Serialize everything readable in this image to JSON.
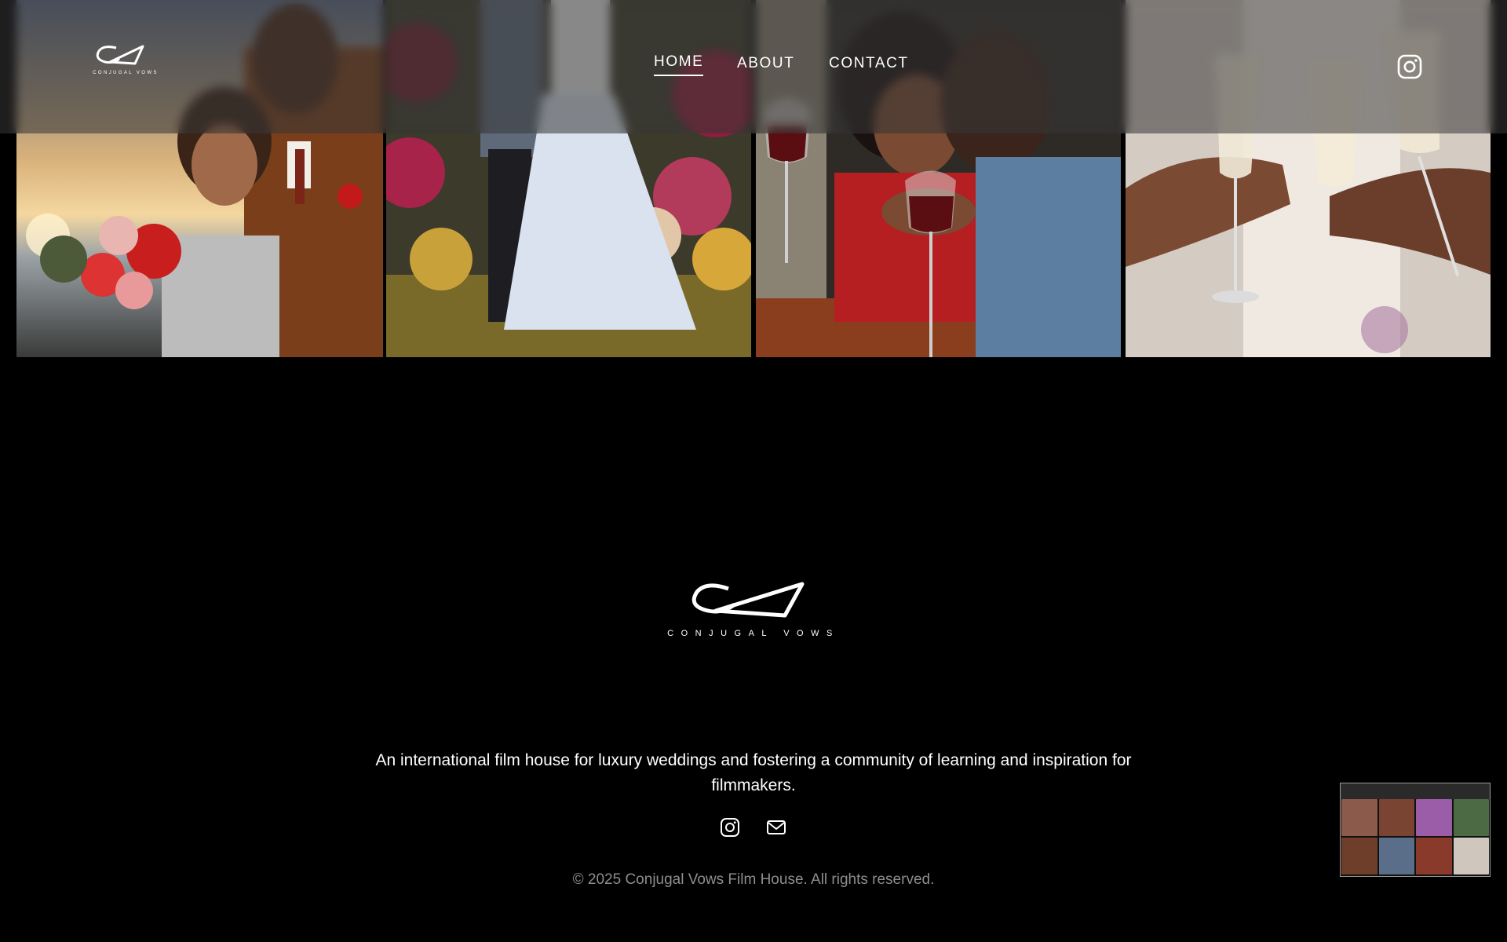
{
  "brand": {
    "name": "CONJUGAL VOWS",
    "monogram": "CV"
  },
  "nav": {
    "home": "HOME",
    "about": "ABOUT",
    "contact": "CONTACT",
    "active": "HOME"
  },
  "gallery": {
    "photos": [
      {
        "subject": "couple-with-bouquet-at-sunset"
      },
      {
        "subject": "bride-and-groom-floral-arch"
      },
      {
        "subject": "couple-with-red-wine"
      },
      {
        "subject": "champagne-toast"
      }
    ]
  },
  "footer": {
    "tagline": "An international film house for luxury weddings and fostering a community of learning and inspiration for filmmakers.",
    "copyright": "© 2025 Conjugal Vows Film House. All rights reserved.",
    "icons": [
      "instagram-icon",
      "mail-icon"
    ]
  },
  "colors": {
    "background": "#000000",
    "text": "#ffffff",
    "muted": "#8d8d92",
    "header_overlay": "rgba(55,55,55,0.55)"
  }
}
